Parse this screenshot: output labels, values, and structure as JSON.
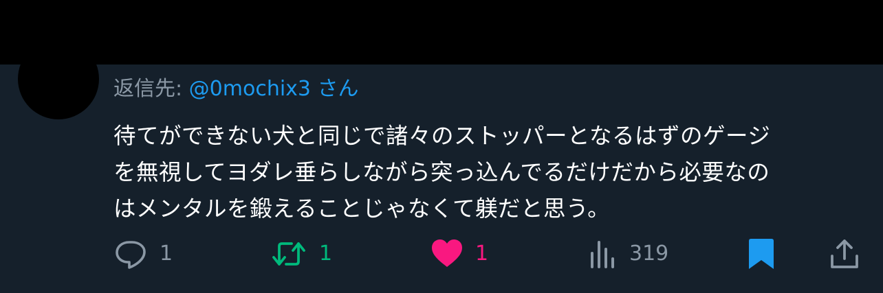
{
  "reply": {
    "prefix": "返信先: ",
    "username": "@0mochix3",
    "suffix": " さん"
  },
  "tweet": {
    "lines": [
      "待てができない犬と同じで諸々のストッパーとなるはずのゲージ",
      "を無視してヨダレ垂らしながら突っ込んでるだけだから必要なの",
      "はメンタルを鍛えることじゃなくて躾だと思う。"
    ]
  },
  "actions": {
    "reply_count": "1",
    "retweet_count": "1",
    "like_count": "1",
    "views_count": "319"
  },
  "colors": {
    "background": "#15202b",
    "muted": "#8b98a5",
    "link": "#1d9bf0",
    "retweet": "#00ba7c",
    "like": "#f91880",
    "bookmark": "#1d9bf0"
  },
  "icons": {
    "reply": "speech-bubble-icon",
    "retweet": "retweet-arrows-icon",
    "like": "heart-icon",
    "views": "bar-chart-icon",
    "bookmark": "bookmark-icon",
    "share": "share-upload-icon"
  }
}
